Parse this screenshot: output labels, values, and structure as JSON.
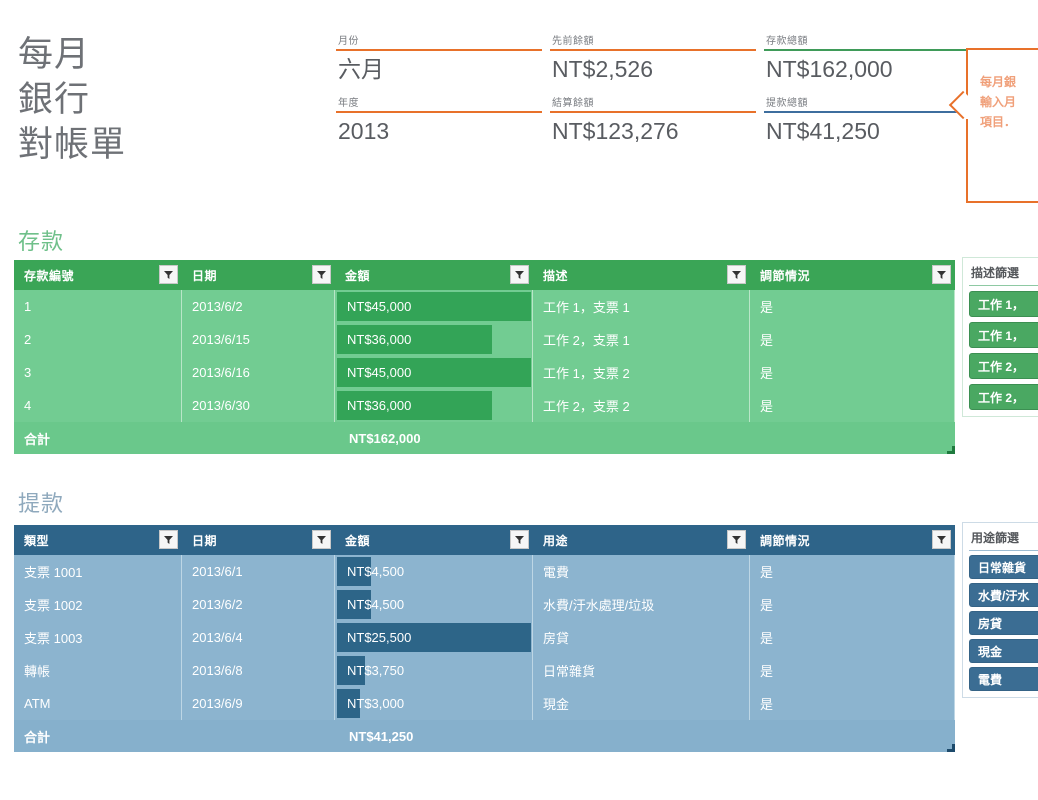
{
  "doc": {
    "title_lines": [
      "每月",
      "銀行",
      "對帳單"
    ]
  },
  "summary": {
    "fields": [
      {
        "label": "月份",
        "value": "六月",
        "rule": "orange"
      },
      {
        "label": "先前餘額",
        "value": "NT$2,526",
        "rule": "orange"
      },
      {
        "label": "存款總額",
        "value": "NT$162,000",
        "rule": "green"
      },
      {
        "label": "年度",
        "value": "2013",
        "rule": "orange"
      },
      {
        "label": "結算餘額",
        "value": "NT$123,276",
        "rule": "orange"
      },
      {
        "label": "提款總額",
        "value": "NT$41,250",
        "rule": "blue"
      }
    ]
  },
  "callout": {
    "lines": [
      "每月銀",
      "輸入月",
      "項目．"
    ]
  },
  "deposits": {
    "heading": "存款",
    "columns": [
      "存款編號",
      "日期",
      "金額",
      "描述",
      "調節情況"
    ],
    "rows": [
      {
        "id": "1",
        "date": "2013/6/2",
        "amount": "NT$45,000",
        "amount_value": 45000,
        "desc": "工作 1，支票 1",
        "reconciled": "是"
      },
      {
        "id": "2",
        "date": "2013/6/15",
        "amount": "NT$36,000",
        "amount_value": 36000,
        "desc": "工作 2，支票 1",
        "reconciled": "是"
      },
      {
        "id": "3",
        "date": "2013/6/16",
        "amount": "NT$45,000",
        "amount_value": 45000,
        "desc": "工作 1，支票 2",
        "reconciled": "是"
      },
      {
        "id": "4",
        "date": "2013/6/30",
        "amount": "NT$36,000",
        "amount_value": 36000,
        "desc": "工作 2，支票 2",
        "reconciled": "是"
      }
    ],
    "total_label": "合計",
    "total_value": "NT$162,000",
    "slicer": {
      "title": "描述篩選",
      "items": [
        "工作 1，",
        "工作 1，",
        "工作 2，",
        "工作 2，"
      ]
    }
  },
  "withdrawals": {
    "heading": "提款",
    "columns": [
      "類型",
      "日期",
      "金額",
      "用途",
      "調節情況"
    ],
    "rows": [
      {
        "type": "支票 1001",
        "date": "2013/6/1",
        "amount": "NT$4,500",
        "amount_value": 4500,
        "purpose": "電費",
        "reconciled": "是"
      },
      {
        "type": "支票 1002",
        "date": "2013/6/2",
        "amount": "NT$4,500",
        "amount_value": 4500,
        "purpose": "水費/汙水處理/垃圾",
        "reconciled": "是"
      },
      {
        "type": "支票 1003",
        "date": "2013/6/4",
        "amount": "NT$25,500",
        "amount_value": 25500,
        "purpose": "房貸",
        "reconciled": "是"
      },
      {
        "type": "轉帳",
        "date": "2013/6/8",
        "amount": "NT$3,750",
        "amount_value": 3750,
        "purpose": "日常雜貨",
        "reconciled": "是"
      },
      {
        "type": "ATM",
        "date": "2013/6/9",
        "amount": "NT$3,000",
        "amount_value": 3000,
        "purpose": "現金",
        "reconciled": "是"
      }
    ],
    "total_label": "合計",
    "total_value": "NT$41,250",
    "slicer": {
      "title": "用途篩選",
      "items": [
        "日常雜貨",
        "水費/汙水",
        "房貸",
        "現金",
        "電費"
      ]
    }
  },
  "colors": {
    "orange": "#e8712a",
    "green_accent": "#3aa556",
    "blue_accent": "#2e6489",
    "title_gray": "#6e7176"
  }
}
